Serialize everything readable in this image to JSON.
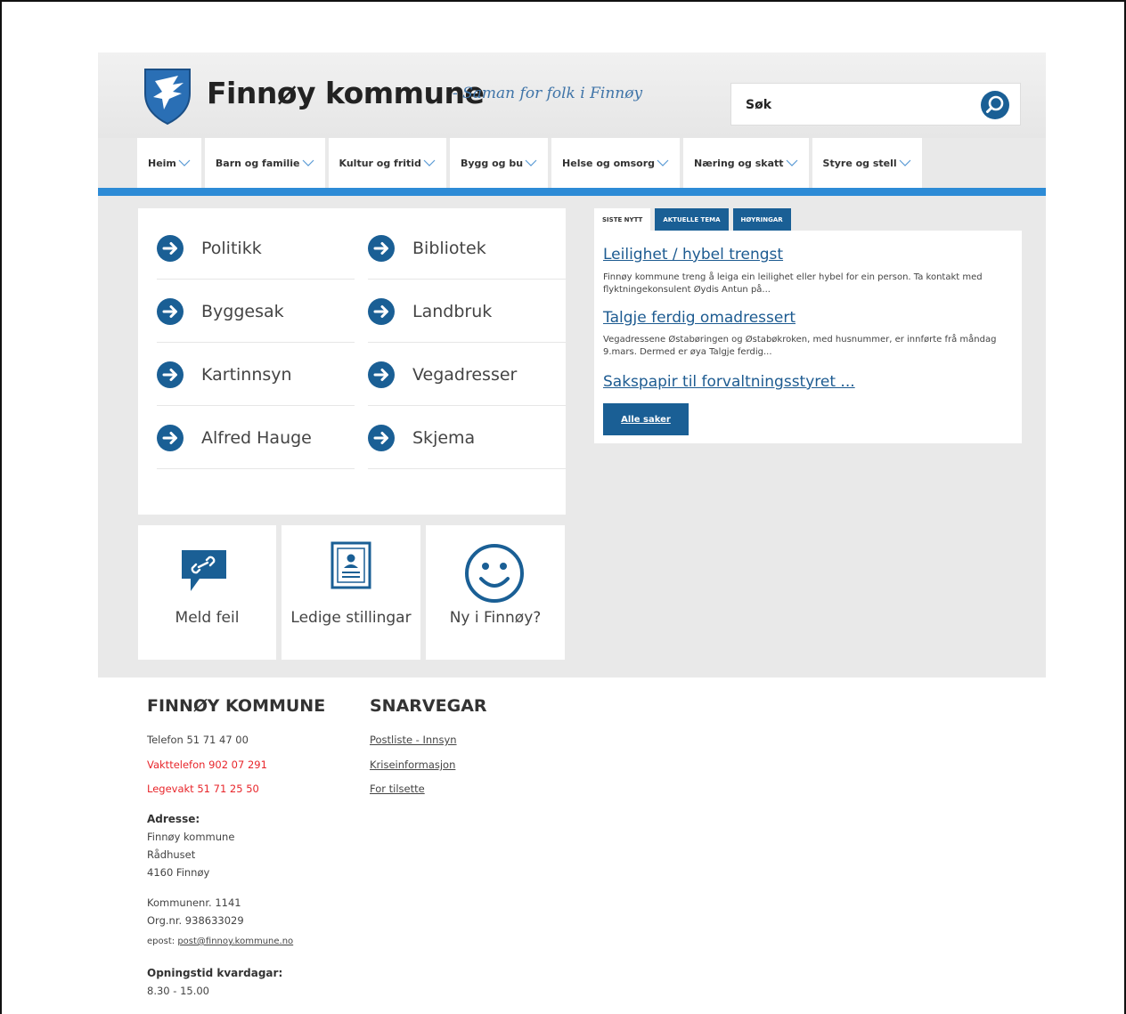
{
  "header": {
    "brand": "Finnøy kommune",
    "tagline": "- Saman for folk i Finnøy",
    "search_placeholder": "Søk"
  },
  "nav": [
    "Heim",
    "Barn og familie",
    "Kultur og fritid",
    "Bygg og bu",
    "Helse og omsorg",
    "Næring og skatt",
    "Styre og stell"
  ],
  "quick_links": [
    "Politikk",
    "Bibliotek",
    "Byggesak",
    "Landbruk",
    "Kartinnsyn",
    "Vegadresser",
    "Alfred Hauge",
    "Skjema"
  ],
  "tiles": [
    "Meld feil",
    "Ledige stillingar",
    "Ny i Finnøy?"
  ],
  "news": {
    "tabs": [
      "SISTE NYTT",
      "AKTUELLE TEMA",
      "HØYRINGAR"
    ],
    "items": [
      {
        "title": "Leilighet / hybel trengst",
        "text": "Finnøy kommune treng å leiga ein leilighet eller hybel for ein person. Ta kontakt med flyktningekonsulent Øydis Antun på..."
      },
      {
        "title": "Talgje ferdig omadressert",
        "text": "Vegadressene Østabøringen og Østabøkroken, med husnummer, er innførte frå måndag 9.mars. Dermed er øya Talgje ferdig..."
      },
      {
        "title": "Sakspapir til forvaltningsstyret ...",
        "text": ""
      }
    ],
    "all_button": "Alle saker"
  },
  "footer": {
    "col1_title": "FINNØY KOMMUNE",
    "phone": "Telefon 51 71 47 00",
    "duty_phone": "Vakttelefon 902 07 291",
    "emergency": "Legevakt 51 71 25 50",
    "address_label": "Adresse:",
    "address_lines": [
      "Finnøy kommune",
      "Rådhuset",
      "4160 Finnøy"
    ],
    "municipality_no": "Kommunenr. 1141",
    "org_no": "Org.nr. 938633029",
    "email_label": "epost:",
    "email": "post@finnoy.kommune.no",
    "hours_label": "Opningstid kvardagar:",
    "hours": "8.30 - 15.00",
    "col2_title": "SNARVEGAR",
    "shortcuts": [
      "Postliste - Innsyn",
      "Kriseinformasjon",
      "For tilsette"
    ]
  },
  "colors": {
    "brand_blue": "#1a5f95",
    "rule_blue": "#2d8bd6",
    "alert_red": "#e8262b"
  }
}
